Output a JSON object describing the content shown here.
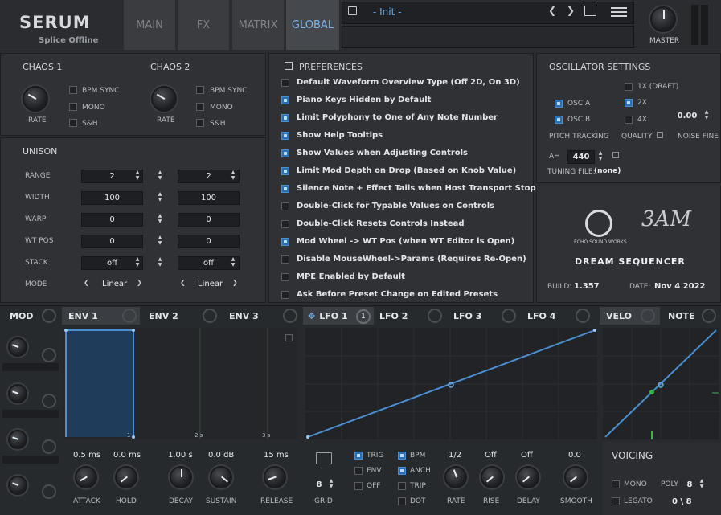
{
  "header": {
    "logo": "SERUM",
    "subtitle": "Splice Offline",
    "tabs": [
      "MAIN",
      "FX",
      "MATRIX",
      "GLOBAL"
    ],
    "preset": "- Init -",
    "master_label": "MASTER"
  },
  "chaos1": {
    "title": "CHAOS 1",
    "opts": [
      "BPM SYNC",
      "MONO",
      "S&H"
    ],
    "knob": "RATE"
  },
  "chaos2": {
    "title": "CHAOS 2",
    "opts": [
      "BPM SYNC",
      "MONO",
      "S&H"
    ],
    "knob": "RATE"
  },
  "unison": {
    "title": "UNISON",
    "rows": [
      {
        "label": "RANGE",
        "a": "2",
        "b": "2"
      },
      {
        "label": "WIDTH",
        "a": "100",
        "b": "100"
      },
      {
        "label": "WARP",
        "a": "0",
        "b": "0"
      },
      {
        "label": "WT POS",
        "a": "0",
        "b": "0"
      },
      {
        "label": "STACK",
        "a": "off",
        "b": "off"
      },
      {
        "label": "MODE",
        "a": "Linear",
        "b": "Linear"
      }
    ]
  },
  "prefs": {
    "title": "PREFERENCES",
    "items": [
      {
        "text": "Default Waveform Overview Type (Off 2D, On 3D)",
        "on": false
      },
      {
        "text": "Piano Keys Hidden by Default",
        "on": true
      },
      {
        "text": "Limit Polyphony to One of Any Note Number",
        "on": true
      },
      {
        "text": "Show Help Tooltips",
        "on": true
      },
      {
        "text": "Show Values when Adjusting Controls",
        "on": true
      },
      {
        "text": "Limit Mod Depth on Drop (Based on Knob Value)",
        "on": true
      },
      {
        "text": "Silence Note + Effect Tails when Host Transport Stops",
        "on": true
      },
      {
        "text": "Double-Click for Typable Values on Controls",
        "on": false
      },
      {
        "text": "Double-Click Resets Controls Instead",
        "on": false
      },
      {
        "text": "Mod Wheel -> WT Pos (when WT Editor is Open)",
        "on": true
      },
      {
        "text": "Disable MouseWheel->Params (Requires Re-Open)",
        "on": false
      },
      {
        "text": "MPE Enabled by Default",
        "on": false
      },
      {
        "text": "Ask Before Preset Change on Edited Presets",
        "on": false
      }
    ]
  },
  "osc": {
    "title": "OSCILLATOR SETTINGS",
    "osca": "OSC A",
    "oscb": "OSC B",
    "q1": "1X (DRAFT)",
    "q2": "2X",
    "q4": "4X",
    "pitch": "PITCH TRACKING",
    "quality": "QUALITY",
    "noise_fine": "NOISE FINE",
    "noise_val": "0.00",
    "a_label": "A=",
    "a_val": "440",
    "tuning_label": "TUNING FILE:",
    "tuning_val": "(none)"
  },
  "brand": {
    "echo": "ECHO SOUND WORKS",
    "dream": "DREAM SEQUENCER",
    "build_label": "BUILD:",
    "build_val": "1.357",
    "date_label": "DATE:",
    "date_val": "Nov  4 2022"
  },
  "mod": {
    "title": "MOD",
    "tabs": [
      "ENV 1",
      "ENV 2",
      "ENV 3",
      "LFO 1",
      "LFO 2",
      "LFO 3",
      "LFO 4",
      "VELO",
      "NOTE"
    ],
    "lfo_badge": "1"
  },
  "env": {
    "marks": [
      "1",
      "2 s",
      "3 s"
    ],
    "attack": "0.5 ms",
    "hold": "0.0 ms",
    "decay": "1.00 s",
    "sustain": "0.0 dB",
    "release": "15 ms",
    "labels": [
      "ATTACK",
      "HOLD",
      "DECAY",
      "SUSTAIN",
      "RELEASE"
    ]
  },
  "lfo": {
    "grid_val": "8",
    "grid_label": "GRID",
    "trig": "TRIG",
    "envm": "ENV",
    "off": "OFF",
    "bpm": "BPM",
    "anch": "ANCH",
    "trip": "TRIP",
    "dot": "DOT",
    "rate": "1/2",
    "rise": "Off",
    "delay": "Off",
    "smooth": "0.0",
    "knobs": [
      "RATE",
      "RISE",
      "DELAY",
      "SMOOTH"
    ]
  },
  "voicing": {
    "title": "VOICING",
    "mono": "MONO",
    "legato": "LEGATO",
    "poly_label": "POLY",
    "poly_val": "8",
    "count": "0  \\ 8"
  },
  "colors": {
    "accent": "#4c8fd1",
    "bg": "#2b2d30"
  }
}
